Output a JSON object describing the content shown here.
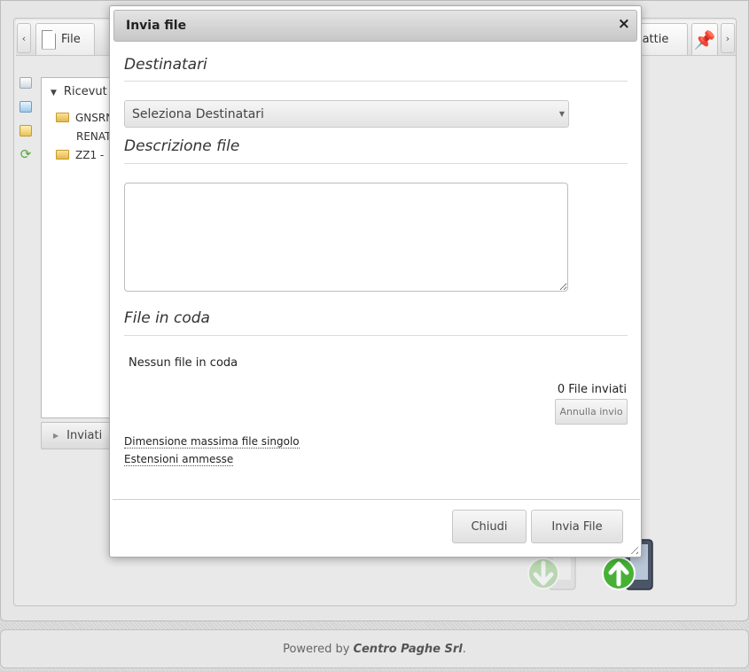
{
  "background": {
    "tabs": [
      {
        "label": "File"
      },
      {
        "label": "alattie"
      }
    ],
    "tree": {
      "header": "Ricevut",
      "items": [
        {
          "label": "GNSRN"
        },
        {
          "label": "RENAT"
        },
        {
          "label": "ZZ1 -"
        }
      ],
      "inviati_label": "Inviati"
    }
  },
  "modal": {
    "title": "Invia file",
    "close_icon": "×",
    "recipients": {
      "heading": "Destinatari",
      "select_value": "Seleziona Destinatari"
    },
    "description": {
      "heading": "Descrizione file",
      "value": ""
    },
    "queue": {
      "heading": "File in coda",
      "empty_text": "Nessun file in coda",
      "sent_count": "0 File inviati",
      "cancel_label": "Annulla invio"
    },
    "links": {
      "max_size": "Dimensione massima file singolo",
      "extensions": "Estensioni ammesse"
    },
    "buttons": {
      "close": "Chiudi",
      "send": "Invia File"
    }
  },
  "footer": {
    "prefix": "Powered by",
    "company": "Centro Paghe Srl",
    "suffix": "."
  },
  "colors": {
    "modal_title_bg": "#d6d6d6",
    "upload_icon": "#46b136",
    "link_underline": "#555555"
  },
  "icons": [
    "chevron-left-icon",
    "file-icon",
    "pin-icon",
    "chevron-right-icon",
    "grid-icon",
    "edit-icon",
    "folder-star-icon",
    "refresh-icon",
    "folder-icon",
    "download-icon",
    "upload-icon",
    "close-icon",
    "resize-grip-icon"
  ]
}
